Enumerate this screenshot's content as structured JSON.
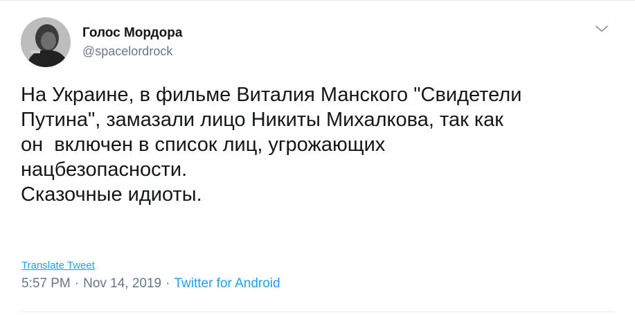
{
  "tweet": {
    "author": {
      "display_name": "Голос Мордора",
      "handle": "@spacelordrock",
      "avatar_icon": "avatar-photo"
    },
    "menu_icon": "chevron-down-icon",
    "text": "На Украине, в фильме Виталия Манского \"Свидетели\nПутина\", замазали лицо Никиты Михалкова, так как\nон  включен в список лиц, угрожающих\nнацбезопасности.\nСказочные идиоты.",
    "translate_label": "Translate Tweet",
    "time": "5:57 PM",
    "separator": "·",
    "date": "Nov 14, 2019",
    "source": "Twitter for Android"
  },
  "colors": {
    "text": "#14171a",
    "secondary": "#657786",
    "link": "#1da1f2",
    "border": "#e6ecf0"
  }
}
